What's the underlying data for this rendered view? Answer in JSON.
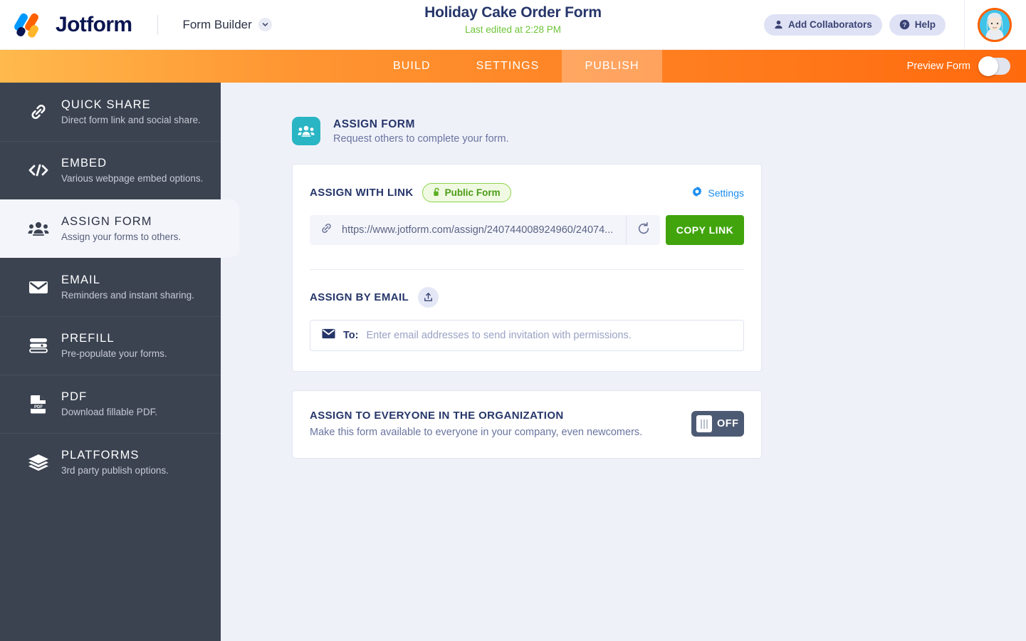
{
  "header": {
    "brand_name": "Jotform",
    "product_menu": "Form Builder",
    "form_title": "Holiday Cake Order Form",
    "last_edited": "Last edited at 2:28 PM",
    "add_collaborators": "Add Collaborators",
    "help": "Help",
    "icons": {
      "logo": "jotform-logo-icon",
      "chevron": "chevron-down-icon",
      "person": "person-icon",
      "question": "question-mark-icon",
      "avatar": "user-avatar-icon"
    }
  },
  "navbar": {
    "tabs": [
      {
        "label": "BUILD",
        "active": false
      },
      {
        "label": "SETTINGS",
        "active": false
      },
      {
        "label": "PUBLISH",
        "active": true
      }
    ],
    "preview_label": "Preview Form",
    "preview_enabled": false
  },
  "sidebar": {
    "items": [
      {
        "title": "QUICK SHARE",
        "desc": "Direct form link and social share.",
        "icon": "link-chain-icon",
        "active": false
      },
      {
        "title": "EMBED",
        "desc": "Various webpage embed options.",
        "icon": "code-brackets-icon",
        "active": false
      },
      {
        "title": "ASSIGN FORM",
        "desc": "Assign your forms to others.",
        "icon": "people-group-icon",
        "active": true
      },
      {
        "title": "EMAIL",
        "desc": "Reminders and instant sharing.",
        "icon": "envelope-icon",
        "active": false
      },
      {
        "title": "PREFILL",
        "desc": "Pre-populate your forms.",
        "icon": "form-lines-icon",
        "active": false
      },
      {
        "title": "PDF",
        "desc": "Download fillable PDF.",
        "icon": "pdf-document-icon",
        "active": false
      },
      {
        "title": "PLATFORMS",
        "desc": "3rd party publish options.",
        "icon": "layers-stack-icon",
        "active": false
      }
    ]
  },
  "main": {
    "section": {
      "title": "ASSIGN FORM",
      "subtitle": "Request others to complete your form.",
      "icon": "people-group-icon"
    },
    "assign_with_link": {
      "title": "ASSIGN WITH LINK",
      "badge_label": "Public Form",
      "badge_icon": "unlock-icon",
      "settings_label": "Settings",
      "settings_icon": "gear-icon",
      "link_icon": "link-chain-icon",
      "url": "https://www.jotform.com/assign/240744008924960/24074...",
      "refresh_icon": "refresh-icon",
      "copy_label": "COPY LINK"
    },
    "assign_by_email": {
      "title": "ASSIGN BY EMAIL",
      "upload_icon": "upload-icon",
      "mail_icon": "envelope-icon",
      "to_label": "To:",
      "placeholder": "Enter email addresses to send invitation with permissions."
    },
    "assign_org": {
      "title": "ASSIGN TO EVERYONE IN THE ORGANIZATION",
      "subtitle": "Make this form available to everyone in your company, even newcomers.",
      "toggle_state": "OFF"
    }
  },
  "colors": {
    "brand_navy": "#0a1551",
    "orange": "#ff6100",
    "green": "#41a40c",
    "teal": "#2ab5c4",
    "sidebar": "#3b4351",
    "page_bg": "#eff1f9",
    "link_blue": "#1a8cf0"
  }
}
